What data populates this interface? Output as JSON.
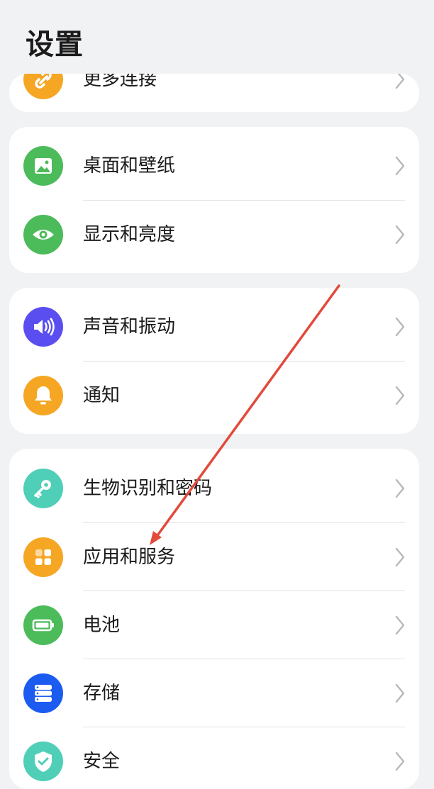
{
  "header": {
    "title": "设置"
  },
  "cards": [
    {
      "items": [
        {
          "label": "更多连接",
          "icon": "link-icon",
          "color": "#f5a623"
        }
      ]
    },
    {
      "items": [
        {
          "label": "桌面和壁纸",
          "icon": "wallpaper-icon",
          "color": "#4cbb5a"
        },
        {
          "label": "显示和亮度",
          "icon": "eye-icon",
          "color": "#4cbb5a"
        }
      ]
    },
    {
      "items": [
        {
          "label": "声音和振动",
          "icon": "speaker-icon",
          "color": "#5b4ef0"
        },
        {
          "label": "通知",
          "icon": "bell-icon",
          "color": "#f5a623"
        }
      ]
    },
    {
      "items": [
        {
          "label": "生物识别和密码",
          "icon": "key-icon",
          "color": "#4fcfb7"
        },
        {
          "label": "应用和服务",
          "icon": "apps-grid-icon",
          "color": "#f5a623"
        },
        {
          "label": "电池",
          "icon": "battery-icon",
          "color": "#4cbb5a"
        },
        {
          "label": "存储",
          "icon": "storage-icon",
          "color": "#1b5bf0"
        },
        {
          "label": "安全",
          "icon": "shield-icon",
          "color": "#4fcfb7"
        }
      ]
    }
  ],
  "annotation": {
    "type": "arrow",
    "color": "#e24a3b"
  }
}
